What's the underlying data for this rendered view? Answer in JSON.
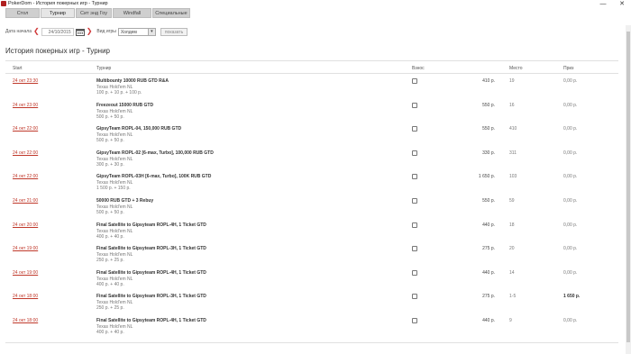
{
  "window": {
    "title": "PokerDom - История покерных игр - Турнир",
    "minimize": "—",
    "close": "✕"
  },
  "tabs": [
    "Стол",
    "Турнир",
    "Сит энд Гоу",
    "Windfall",
    "Специальные"
  ],
  "filter": {
    "date_label": "Дата начала",
    "date_value": "24/10/2015",
    "prev_arrow": "❮",
    "next_arrow": "❯",
    "gametype_label": "Вид игры",
    "gametype_value": "Холдем",
    "show_button": "показать"
  },
  "page_title": "История покерных игр - Турнир",
  "columns": {
    "start": "Start",
    "tournament": "Турнир",
    "buyin": "Взнос",
    "place": "Место",
    "prize": "Приз"
  },
  "rows": [
    {
      "start": "24 окт 23:30",
      "name": "Multibounty 10000 RUB GTD R&A",
      "game": "Texas Hold'em NL",
      "buyin_detail": "100 p. + 10 p. + 100 p.",
      "buyin": "410 р.",
      "place": "19",
      "prize": "0,00 р."
    },
    {
      "start": "24 окт 23:00",
      "name": "Freezeout 15000 RUB GTD",
      "game": "Texas Hold'em NL",
      "buyin_detail": "500 p. + 50 p.",
      "buyin": "550 р.",
      "place": "16",
      "prize": "0,00 р."
    },
    {
      "start": "24 окт 22:00",
      "name": "GipsyTeam ROPL-04, 150,000 RUB GTD",
      "game": "Texas Hold'em NL",
      "buyin_detail": "500 p. + 50 p.",
      "buyin": "550 р.",
      "place": "410",
      "prize": "0,00 р."
    },
    {
      "start": "24 окт 22:00",
      "name": "GipsyTeam ROPL-02 [6-max, Turbo], 100,000 RUB GTD",
      "game": "Texas Hold'em NL",
      "buyin_detail": "300 p. + 30 p.",
      "buyin": "330 р.",
      "place": "311",
      "prize": "0,00 р."
    },
    {
      "start": "24 окт 22:00",
      "name": "GipsyTeam ROPL-03H [6-max, Turbo], 100K RUB GTD",
      "game": "Texas Hold'em NL",
      "buyin_detail": "1 500 p. + 150 p.",
      "buyin": "1 650 р.",
      "place": "103",
      "prize": "0,00 р."
    },
    {
      "start": "24 окт 21:00",
      "name": "50000 RUB GTD + 3 Rebuy",
      "game": "Texas Hold'em NL",
      "buyin_detail": "500 p. + 50 p.",
      "buyin": "550 р.",
      "place": "59",
      "prize": "0,00 р."
    },
    {
      "start": "24 окт 20:00",
      "name": "Final Satellite to Gipsyteam ROPL-4H, 1 Ticket GTD",
      "game": "Texas Hold'em NL",
      "buyin_detail": "400 p. + 40 p.",
      "buyin": "440 р.",
      "place": "18",
      "prize": "0,00 р."
    },
    {
      "start": "24 окт 19:00",
      "name": "Final Satellite to Gipsyteam ROPL-3H, 1 Ticket GTD",
      "game": "Texas Hold'em NL",
      "buyin_detail": "250 p. + 25 p.",
      "buyin": "275 р.",
      "place": "20",
      "prize": "0,00 р."
    },
    {
      "start": "24 окт 19:00",
      "name": "Final Satellite to Gipsyteam ROPL-4H, 1 Ticket GTD",
      "game": "Texas Hold'em NL",
      "buyin_detail": "400 p. + 40 p.",
      "buyin": "440 р.",
      "place": "14",
      "prize": "0,00 р."
    },
    {
      "start": "24 окт 18:00",
      "name": "Final Satellite to Gipsyteam ROPL-3H, 1 Ticket GTD",
      "game": "Texas Hold'em NL",
      "buyin_detail": "250 p. + 25 p.",
      "buyin": "275 р.",
      "place": "1-5",
      "prize": "1 650 р.",
      "win": true
    },
    {
      "start": "24 окт 18:00",
      "name": "Final Satellite to Gipsyteam ROPL-4H, 1 Ticket GTD",
      "game": "Texas Hold'em NL",
      "buyin_detail": "400 p. + 40 p.",
      "buyin": "440 р.",
      "place": "9",
      "prize": "0,00 р."
    }
  ],
  "colors": {
    "accent_red": "#c0392b",
    "tab_bg": "#cfcfcf"
  }
}
